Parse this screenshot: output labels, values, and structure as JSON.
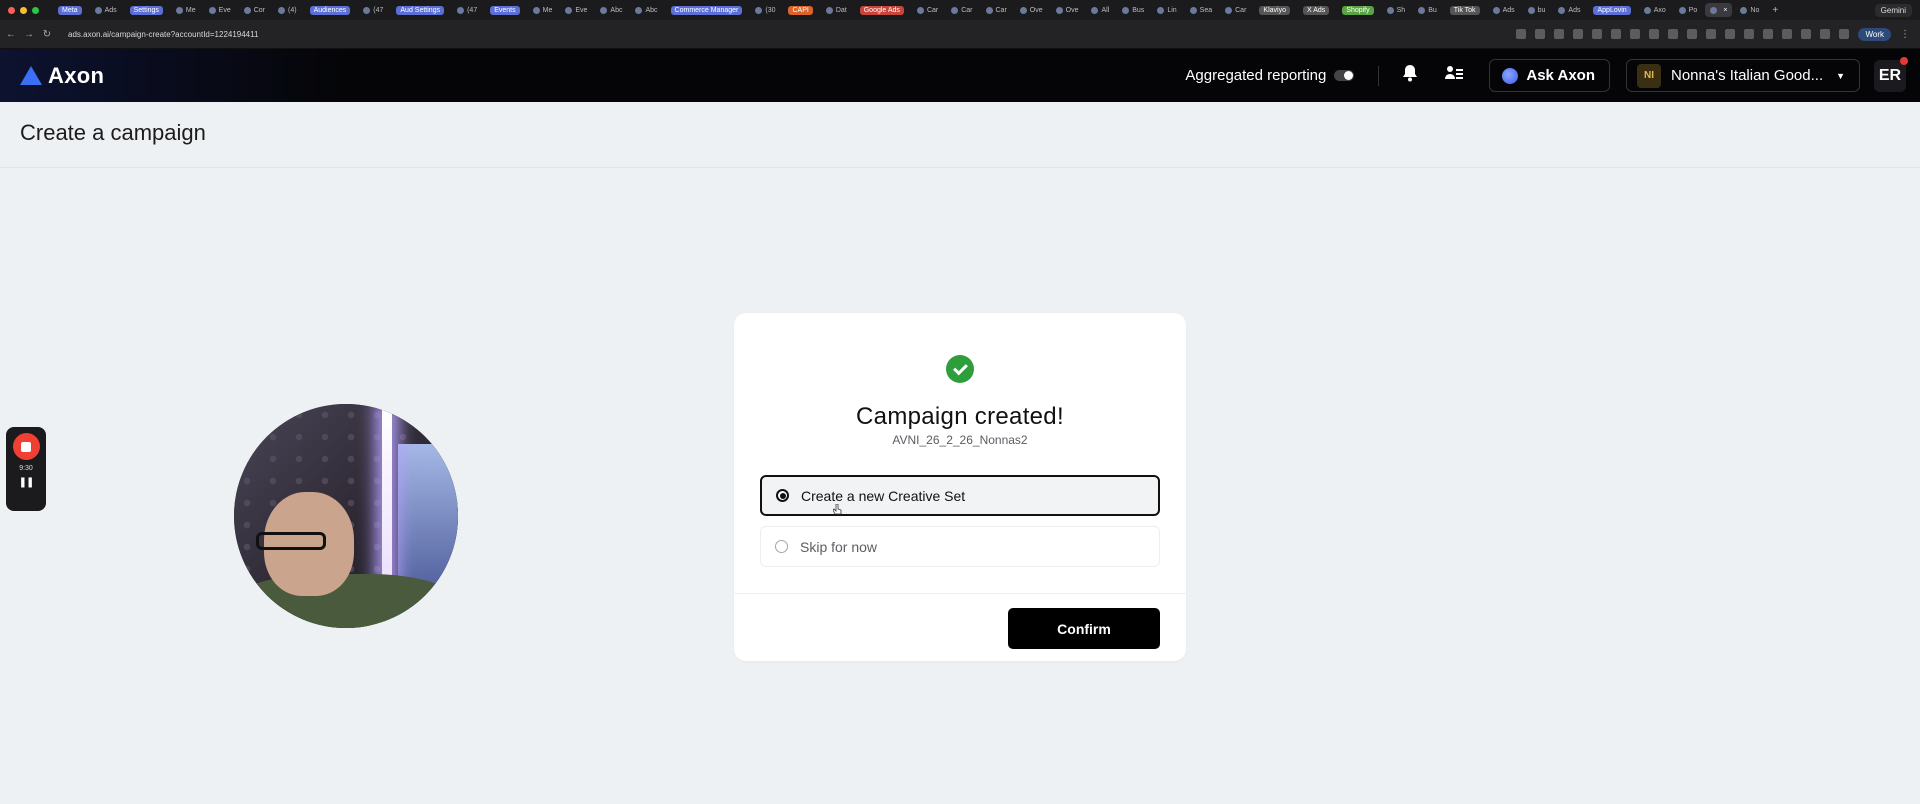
{
  "browser": {
    "tabs": [
      {
        "label": "Meta",
        "pill": "#5b6fd6"
      },
      {
        "label": "Ads"
      },
      {
        "label": "Settings",
        "pill": "#5b6fd6"
      },
      {
        "label": "Me"
      },
      {
        "label": "Eve"
      },
      {
        "label": "Cor"
      },
      {
        "label": "(4)"
      },
      {
        "label": "Audiences",
        "pill": "#5b6fd6"
      },
      {
        "label": "(47"
      },
      {
        "label": "Aud Settings",
        "pill": "#5b6fd6"
      },
      {
        "label": "(47"
      },
      {
        "label": "Events",
        "pill": "#5b6fd6"
      },
      {
        "label": "Me"
      },
      {
        "label": "Eve"
      },
      {
        "label": "Abc"
      },
      {
        "label": "Abc"
      },
      {
        "label": "Commerce Manager",
        "pill": "#5b6fd6"
      },
      {
        "label": "(30"
      },
      {
        "label": "CAPI",
        "pill": "#d9632b"
      },
      {
        "label": "Dat"
      },
      {
        "label": "Google Ads",
        "pill": "#c9453a"
      },
      {
        "label": "Car"
      },
      {
        "label": "Car"
      },
      {
        "label": "Car"
      },
      {
        "label": "Ove"
      },
      {
        "label": "Ove"
      },
      {
        "label": "All"
      },
      {
        "label": "Bus"
      },
      {
        "label": "Lin"
      },
      {
        "label": "Sea"
      },
      {
        "label": "Car"
      },
      {
        "label": "Klaviyo",
        "pill": "#555"
      },
      {
        "label": "X Ads",
        "pill": "#555"
      },
      {
        "label": "Shopify",
        "pill": "#5aa342"
      },
      {
        "label": "Sh"
      },
      {
        "label": "Bu"
      },
      {
        "label": "Tik Tok",
        "pill": "#555"
      },
      {
        "label": "Ads"
      },
      {
        "label": "bu"
      },
      {
        "label": "Ads"
      },
      {
        "label": "AppLovin",
        "pill": "#5b6fd6"
      },
      {
        "label": "Axo"
      },
      {
        "label": "Po"
      },
      {
        "label": "",
        "active": true
      },
      {
        "label": "No"
      }
    ],
    "gemini_label": "Gemini",
    "url": "ads.axon.ai/campaign-create?accountId=1224194411",
    "profile_label": "Work"
  },
  "header": {
    "brand": "Axon",
    "aggregated_label": "Aggregated reporting",
    "aggregated_on": false,
    "ask_label": "Ask Axon",
    "account_initials": "NI",
    "account_name": "Nonna's Italian Good...",
    "user_initials": "ER"
  },
  "page": {
    "title": "Create a campaign"
  },
  "recorder": {
    "time": "9:30"
  },
  "modal": {
    "title": "Campaign created!",
    "campaign_name": "AVNI_26_2_26_Nonnas2",
    "options": [
      {
        "label": "Create a new Creative Set",
        "selected": true
      },
      {
        "label": "Skip for now",
        "selected": false
      }
    ],
    "confirm_label": "Confirm"
  },
  "colors": {
    "success": "#2e9e3d",
    "brand_blue": "#3b6ff5",
    "recorder_red": "#ef4036"
  }
}
